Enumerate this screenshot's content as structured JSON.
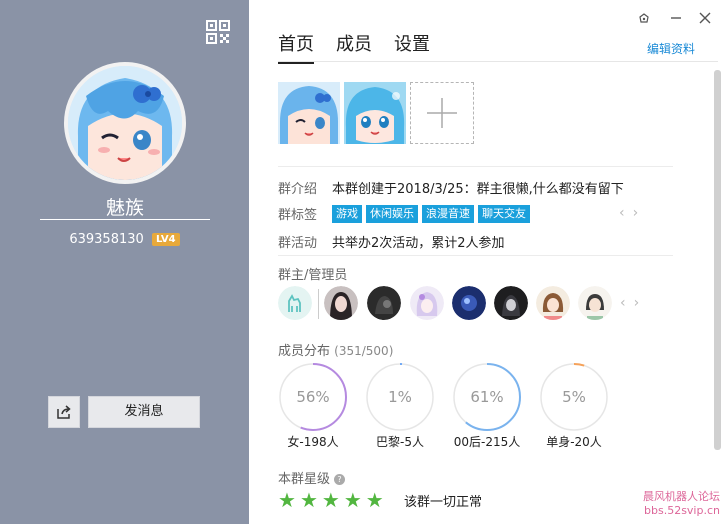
{
  "profile": {
    "group_name": "魅族",
    "group_id": "639358130",
    "level": "LV4",
    "send_message_label": "发消息"
  },
  "tabs": [
    {
      "label": "首页"
    },
    {
      "label": "成员"
    },
    {
      "label": "设置"
    }
  ],
  "edit_label": "编辑资料",
  "info": {
    "intro_label": "群介绍",
    "intro_value": "本群创建于2018/3/25：群主很懒,什么都没有留下",
    "tags_label": "群标签",
    "tags": [
      "游戏",
      "休闲娱乐",
      "浪漫音速",
      "聊天交友"
    ],
    "activity_label": "群活动",
    "activity_value": "共举办2次活动，累计2人参加"
  },
  "admins": {
    "title": "群主/管理员"
  },
  "distribution": {
    "title": "成员分布",
    "count": "(351/500)",
    "items": [
      {
        "pct_text": "56%",
        "label": "女-198人",
        "fraction": 0.56,
        "color": "#b58ae0"
      },
      {
        "pct_text": "1%",
        "label": "巴黎-5人",
        "fraction": 0.01,
        "color": "#6fa8f5"
      },
      {
        "pct_text": "61%",
        "label": "00后-215人",
        "fraction": 0.61,
        "color": "#7ab3ee"
      },
      {
        "pct_text": "5%",
        "label": "单身-20人",
        "fraction": 0.05,
        "color": "#f5a25a"
      }
    ]
  },
  "rating": {
    "title": "本群星级",
    "stars": 5,
    "status": "该群一切正常",
    "star_color": "#52b640"
  },
  "watermark": {
    "line1": "晨风机器人论坛",
    "line2": "bbs.52svip.cn"
  }
}
